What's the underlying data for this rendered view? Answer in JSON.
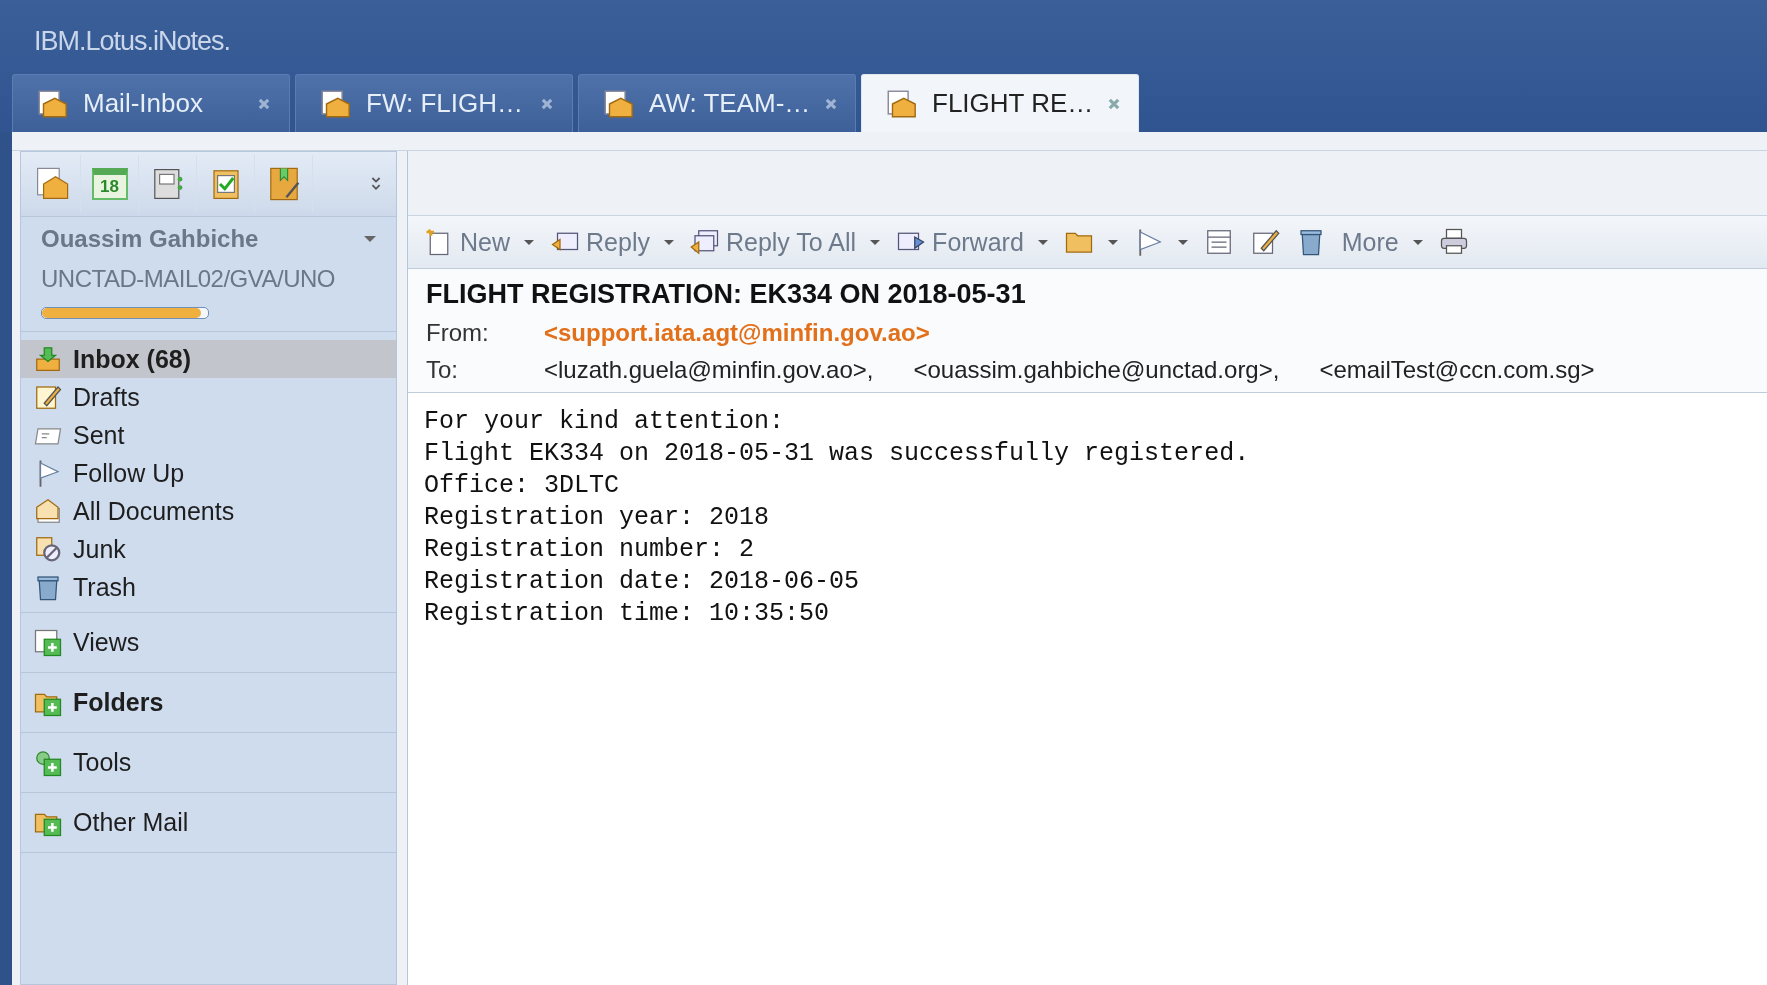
{
  "app": {
    "title": "IBM.Lotus.iNotes."
  },
  "tabs": [
    {
      "label": "Mail-Inbox",
      "selected": false
    },
    {
      "label": "FW: FLIGH…",
      "selected": false
    },
    {
      "label": "AW: TEAM-…",
      "selected": false
    },
    {
      "label": "FLIGHT RE…",
      "selected": true
    }
  ],
  "launcher": [
    {
      "kind": "mail"
    },
    {
      "kind": "calendar",
      "label": "18"
    },
    {
      "kind": "contacts"
    },
    {
      "kind": "todo"
    },
    {
      "kind": "notebook"
    }
  ],
  "account": {
    "name": "Ouassim Gahbiche",
    "server": "UNCTAD-MAIL02/GVA/UNO",
    "quota": {
      "level": 0.96
    }
  },
  "folders": [
    {
      "label": "Inbox (68)",
      "kind": "inbox",
      "selected": true
    },
    {
      "label": "Drafts",
      "kind": "drafts",
      "selected": false
    },
    {
      "label": "Sent",
      "kind": "sent",
      "selected": false
    },
    {
      "label": "Follow Up",
      "kind": "flag",
      "selected": false
    },
    {
      "label": "All Documents",
      "kind": "docs",
      "selected": false
    },
    {
      "label": "Junk",
      "kind": "junk",
      "selected": false
    },
    {
      "label": "Trash",
      "kind": "trash",
      "selected": false
    }
  ],
  "sections": [
    {
      "label": "Views",
      "kind": "views",
      "bold": false
    },
    {
      "label": "Folders",
      "kind": "folders",
      "bold": true
    },
    {
      "label": "Tools",
      "kind": "tools",
      "bold": false
    },
    {
      "label": "Other Mail",
      "kind": "folders",
      "bold": false
    }
  ],
  "toolbar": [
    {
      "kind": "new",
      "label": "New",
      "dropdown": true
    },
    {
      "kind": "reply",
      "label": "Reply",
      "dropdown": true
    },
    {
      "kind": "replyall",
      "label": "Reply To All",
      "dropdown": true
    },
    {
      "kind": "forward",
      "label": "Forward",
      "dropdown": true
    },
    {
      "kind": "folder",
      "dropdown": true
    },
    {
      "kind": "flag",
      "dropdown": true
    },
    {
      "kind": "view",
      "dropdown": false
    },
    {
      "kind": "edit",
      "dropdown": false
    },
    {
      "kind": "trash",
      "dropdown": false
    },
    {
      "kind": "more",
      "label": "More",
      "dropdown": true
    },
    {
      "kind": "print",
      "dropdown": false
    }
  ],
  "message": {
    "subject": "FLIGHT REGISTRATION: EK334 ON 2018-05-31",
    "from_label": "From:",
    "from": "<support.iata.agt@minfin.gov.ao>",
    "to_label": "To:",
    "to": [
      "<luzath.guela@minfin.gov.ao>,",
      "<ouassim.gahbiche@unctad.org>,",
      "<emailTest@ccn.com.sg>"
    ],
    "body": [
      "For your kind attention:",
      "Flight EK334 on 2018-05-31 was successfully registered.",
      "Office: 3DLTC",
      "Registration year: 2018",
      "Registration number: 2",
      "Registration date: 2018-06-05",
      "Registration time: 10:35:50"
    ]
  }
}
